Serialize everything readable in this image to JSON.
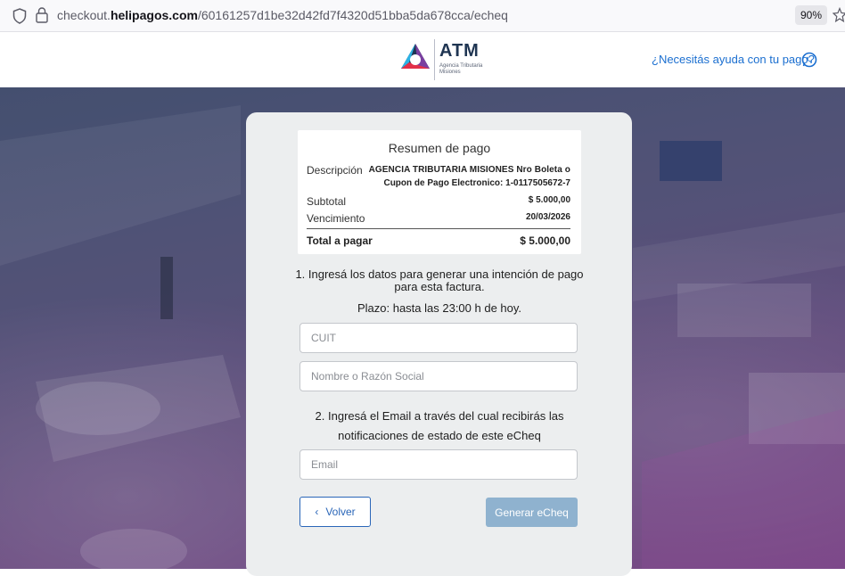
{
  "browser": {
    "url_prefix": "checkout.",
    "url_domain": "helipagos.com",
    "url_path": "/60161257d1be32d42fd7f4320d51bba5da678cca/echeq",
    "zoom": "90%"
  },
  "header": {
    "logo_title": "ATM",
    "logo_subtitle": "Agencia Tributaria Misiones",
    "help_text": "¿Necesitás ayuda con tu pago?",
    "brand_colors": [
      "#1f3552",
      "#2bb3e6",
      "#7a3fa0",
      "#e2304a"
    ]
  },
  "summary": {
    "title": "Resumen de pago",
    "description_label": "Descripción",
    "description_line1": "AGENCIA TRIBUTARIA MISIONES Nro Boleta o",
    "description_line2": "Cupon de Pago Electronico: 1-0117505672-7",
    "subtotal_label": "Subtotal",
    "subtotal_value": "$ 5.000,00",
    "due_label": "Vencimiento",
    "due_value": "20/03/2026",
    "total_label": "Total a pagar",
    "total_value": "$ 5.000,00"
  },
  "form": {
    "step1": "1. Ingresá los datos para generar una intención de pago para esta factura.",
    "deadline": "Plazo: hasta las 23:00 h de hoy.",
    "cuit_placeholder": "CUIT",
    "cuit_value": "",
    "name_placeholder": "Nombre o Razón Social",
    "name_value": "",
    "step2": "2. Ingresá el Email a través del cual recibirás las notificaciones de estado de este eCheq",
    "email_placeholder": "Email",
    "email_value": "",
    "back_label": "Volver",
    "submit_label": "Generar eCheq"
  }
}
